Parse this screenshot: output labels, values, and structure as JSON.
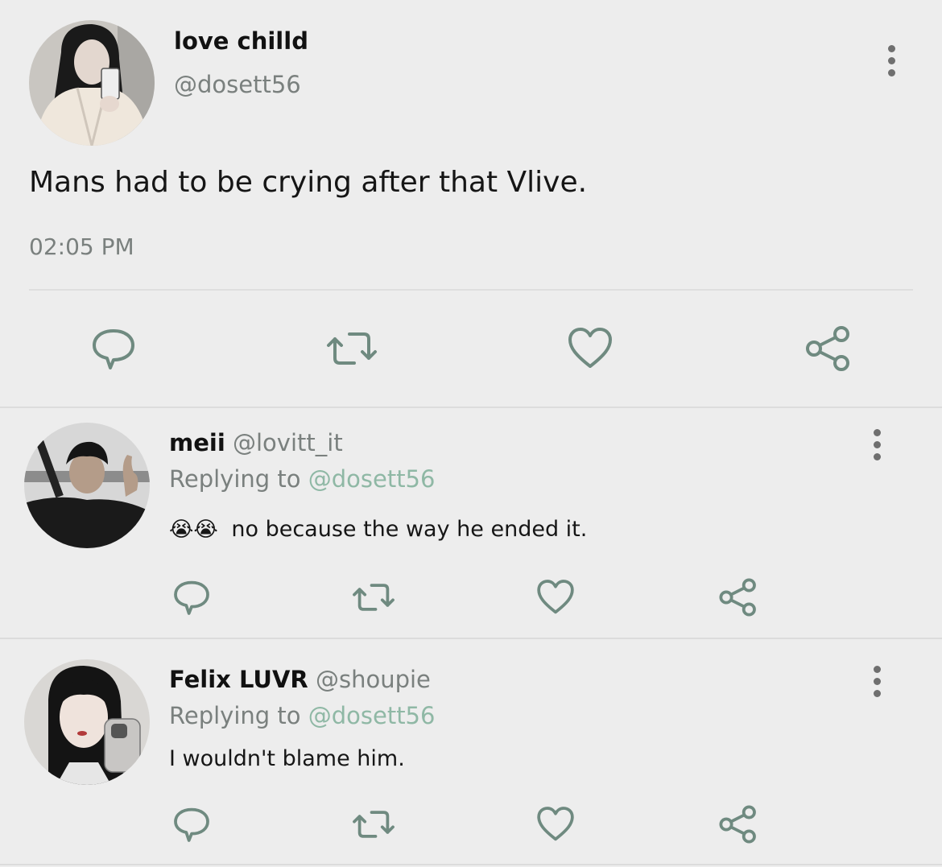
{
  "main_tweet": {
    "display_name": "love chilld",
    "handle": "@dosett56",
    "text": "Mans had to be crying after that Vlive.",
    "time": "02:05 PM"
  },
  "replies": [
    {
      "display_name": "meii",
      "handle": "@lovitt_it",
      "replying_prefix": "Replying to",
      "replying_handle": "@dosett56",
      "emoji": "😭😭",
      "text": "no because the way he ended it."
    },
    {
      "display_name": "Felix LUVR",
      "handle": "@shoupie",
      "replying_prefix": "Replying to",
      "replying_handle": "@dosett56",
      "text": "I wouldn't blame him."
    }
  ],
  "colors": {
    "background": "#ededed",
    "icon": "#6f8a80",
    "reply_link": "#8fb8a5",
    "muted_text": "#7a807e"
  },
  "icons": [
    "comment-icon",
    "retweet-icon",
    "heart-icon",
    "share-icon",
    "more-vertical-icon"
  ]
}
